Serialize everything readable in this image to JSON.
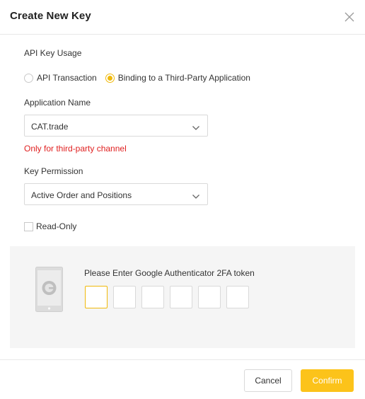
{
  "dialog": {
    "title": "Create New Key"
  },
  "usage": {
    "label": "API Key Usage",
    "options": [
      {
        "label": "API Transaction",
        "checked": false
      },
      {
        "label": "Binding to a Third-Party Application",
        "checked": true
      }
    ]
  },
  "application": {
    "label": "Application Name",
    "selected": "CAT.trade",
    "warning": "Only for third-party channel"
  },
  "permission": {
    "label": "Key Permission",
    "selected": "Active Order and Positions",
    "read_only_label": "Read-Only",
    "read_only_checked": false
  },
  "twofa": {
    "label": "Please Enter Google Authenticator 2FA token",
    "digits": [
      "",
      "",
      "",
      "",
      "",
      ""
    ]
  },
  "footer": {
    "cancel_label": "Cancel",
    "confirm_label": "Confirm"
  },
  "colors": {
    "accent": "#f0b90b",
    "confirm_bg": "#fcc31a",
    "warning": "#e02020"
  }
}
